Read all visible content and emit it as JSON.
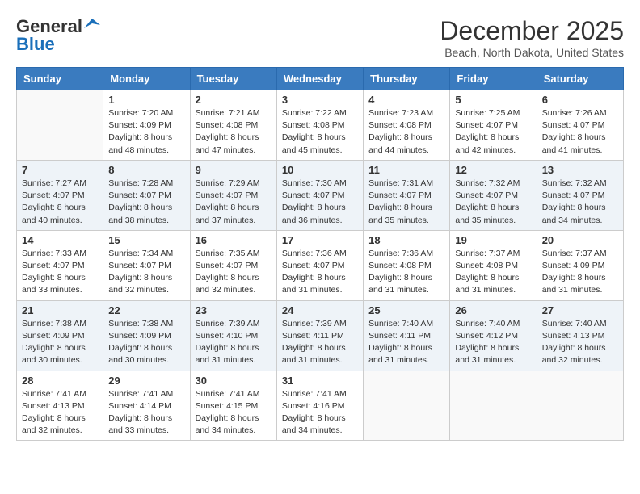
{
  "header": {
    "logo_line1": "General",
    "logo_line2": "Blue",
    "month_title": "December 2025",
    "location": "Beach, North Dakota, United States"
  },
  "days_of_week": [
    "Sunday",
    "Monday",
    "Tuesday",
    "Wednesday",
    "Thursday",
    "Friday",
    "Saturday"
  ],
  "weeks": [
    [
      {
        "day": "",
        "info": ""
      },
      {
        "day": "1",
        "info": "Sunrise: 7:20 AM\nSunset: 4:09 PM\nDaylight: 8 hours\nand 48 minutes."
      },
      {
        "day": "2",
        "info": "Sunrise: 7:21 AM\nSunset: 4:08 PM\nDaylight: 8 hours\nand 47 minutes."
      },
      {
        "day": "3",
        "info": "Sunrise: 7:22 AM\nSunset: 4:08 PM\nDaylight: 8 hours\nand 45 minutes."
      },
      {
        "day": "4",
        "info": "Sunrise: 7:23 AM\nSunset: 4:08 PM\nDaylight: 8 hours\nand 44 minutes."
      },
      {
        "day": "5",
        "info": "Sunrise: 7:25 AM\nSunset: 4:07 PM\nDaylight: 8 hours\nand 42 minutes."
      },
      {
        "day": "6",
        "info": "Sunrise: 7:26 AM\nSunset: 4:07 PM\nDaylight: 8 hours\nand 41 minutes."
      }
    ],
    [
      {
        "day": "7",
        "info": "Sunrise: 7:27 AM\nSunset: 4:07 PM\nDaylight: 8 hours\nand 40 minutes."
      },
      {
        "day": "8",
        "info": "Sunrise: 7:28 AM\nSunset: 4:07 PM\nDaylight: 8 hours\nand 38 minutes."
      },
      {
        "day": "9",
        "info": "Sunrise: 7:29 AM\nSunset: 4:07 PM\nDaylight: 8 hours\nand 37 minutes."
      },
      {
        "day": "10",
        "info": "Sunrise: 7:30 AM\nSunset: 4:07 PM\nDaylight: 8 hours\nand 36 minutes."
      },
      {
        "day": "11",
        "info": "Sunrise: 7:31 AM\nSunset: 4:07 PM\nDaylight: 8 hours\nand 35 minutes."
      },
      {
        "day": "12",
        "info": "Sunrise: 7:32 AM\nSunset: 4:07 PM\nDaylight: 8 hours\nand 35 minutes."
      },
      {
        "day": "13",
        "info": "Sunrise: 7:32 AM\nSunset: 4:07 PM\nDaylight: 8 hours\nand 34 minutes."
      }
    ],
    [
      {
        "day": "14",
        "info": "Sunrise: 7:33 AM\nSunset: 4:07 PM\nDaylight: 8 hours\nand 33 minutes."
      },
      {
        "day": "15",
        "info": "Sunrise: 7:34 AM\nSunset: 4:07 PM\nDaylight: 8 hours\nand 32 minutes."
      },
      {
        "day": "16",
        "info": "Sunrise: 7:35 AM\nSunset: 4:07 PM\nDaylight: 8 hours\nand 32 minutes."
      },
      {
        "day": "17",
        "info": "Sunrise: 7:36 AM\nSunset: 4:07 PM\nDaylight: 8 hours\nand 31 minutes."
      },
      {
        "day": "18",
        "info": "Sunrise: 7:36 AM\nSunset: 4:08 PM\nDaylight: 8 hours\nand 31 minutes."
      },
      {
        "day": "19",
        "info": "Sunrise: 7:37 AM\nSunset: 4:08 PM\nDaylight: 8 hours\nand 31 minutes."
      },
      {
        "day": "20",
        "info": "Sunrise: 7:37 AM\nSunset: 4:09 PM\nDaylight: 8 hours\nand 31 minutes."
      }
    ],
    [
      {
        "day": "21",
        "info": "Sunrise: 7:38 AM\nSunset: 4:09 PM\nDaylight: 8 hours\nand 30 minutes."
      },
      {
        "day": "22",
        "info": "Sunrise: 7:38 AM\nSunset: 4:09 PM\nDaylight: 8 hours\nand 30 minutes."
      },
      {
        "day": "23",
        "info": "Sunrise: 7:39 AM\nSunset: 4:10 PM\nDaylight: 8 hours\nand 31 minutes."
      },
      {
        "day": "24",
        "info": "Sunrise: 7:39 AM\nSunset: 4:11 PM\nDaylight: 8 hours\nand 31 minutes."
      },
      {
        "day": "25",
        "info": "Sunrise: 7:40 AM\nSunset: 4:11 PM\nDaylight: 8 hours\nand 31 minutes."
      },
      {
        "day": "26",
        "info": "Sunrise: 7:40 AM\nSunset: 4:12 PM\nDaylight: 8 hours\nand 31 minutes."
      },
      {
        "day": "27",
        "info": "Sunrise: 7:40 AM\nSunset: 4:13 PM\nDaylight: 8 hours\nand 32 minutes."
      }
    ],
    [
      {
        "day": "28",
        "info": "Sunrise: 7:41 AM\nSunset: 4:13 PM\nDaylight: 8 hours\nand 32 minutes."
      },
      {
        "day": "29",
        "info": "Sunrise: 7:41 AM\nSunset: 4:14 PM\nDaylight: 8 hours\nand 33 minutes."
      },
      {
        "day": "30",
        "info": "Sunrise: 7:41 AM\nSunset: 4:15 PM\nDaylight: 8 hours\nand 34 minutes."
      },
      {
        "day": "31",
        "info": "Sunrise: 7:41 AM\nSunset: 4:16 PM\nDaylight: 8 hours\nand 34 minutes."
      },
      {
        "day": "",
        "info": ""
      },
      {
        "day": "",
        "info": ""
      },
      {
        "day": "",
        "info": ""
      }
    ]
  ]
}
